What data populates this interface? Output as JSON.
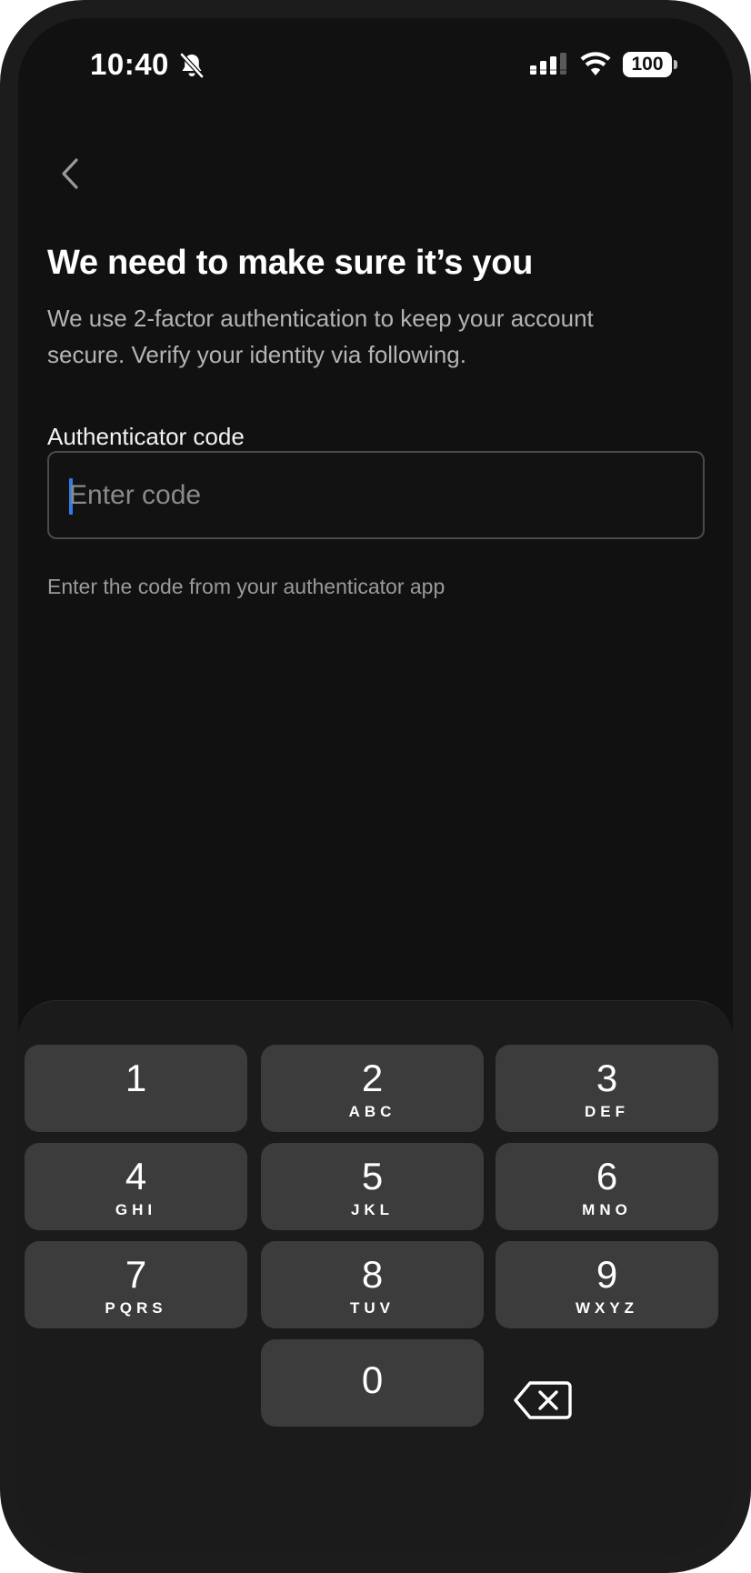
{
  "status_bar": {
    "time": "10:40",
    "battery": "100",
    "icons": [
      "bell-off-icon",
      "cellular-signal-icon",
      "wifi-icon",
      "battery-icon"
    ]
  },
  "nav": {
    "back_icon": "chevron-left-icon"
  },
  "header": {
    "title": "We need to make sure it’s you",
    "subtitle": "We use 2-factor authentication to keep your account secure. Verify your identity via following."
  },
  "form": {
    "label": "Authenticator code",
    "placeholder": "Enter code",
    "value": "",
    "helper": "Enter the code from your authenticator app"
  },
  "keypad": {
    "keys": [
      {
        "digit": "1",
        "letters": ""
      },
      {
        "digit": "2",
        "letters": "ABC"
      },
      {
        "digit": "3",
        "letters": "DEF"
      },
      {
        "digit": "4",
        "letters": "GHI"
      },
      {
        "digit": "5",
        "letters": "JKL"
      },
      {
        "digit": "6",
        "letters": "MNO"
      },
      {
        "digit": "7",
        "letters": "PQRS"
      },
      {
        "digit": "8",
        "letters": "TUV"
      },
      {
        "digit": "9",
        "letters": "WXYZ"
      },
      {
        "digit": "0",
        "letters": ""
      }
    ],
    "delete_icon": "backspace-icon"
  },
  "colors": {
    "background": "#111111",
    "key": "#3c3c3c",
    "caret": "#2f7ee6",
    "text": "#ffffff",
    "muted_text": "#b4b4b4"
  }
}
